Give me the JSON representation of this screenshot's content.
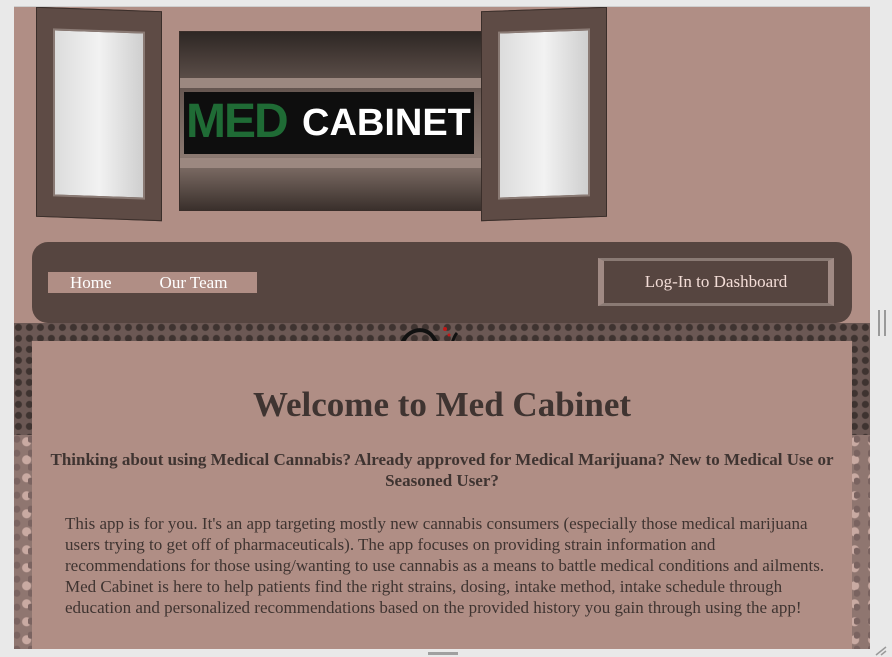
{
  "header": {
    "logo_med": "MED",
    "logo_cabinet": "CABINET"
  },
  "nav": {
    "home_label": "Home",
    "team_label": "Our Team",
    "login_label": "Log-In to Dashboard"
  },
  "main": {
    "title": "Welcome to Med Cabinet",
    "subtitle": "Thinking about using Medical Cannabis? Already approved for Medical Marijuana? New to Medical Use or Seasoned User?",
    "body": "This app is for you. It's an app targeting mostly new cannabis consumers (especially those medical marijuana users trying to get off of pharmaceuticals). The app focuses on providing strain information and recommendations for those using/wanting to use cannabis as a means to battle medical conditions and ailments. Med Cabinet is here to help patients find the right strains, dosing, intake method, intake schedule through education and personalized recommendations based on the provided history you gain through using the app!"
  },
  "colors": {
    "page_bg": "#b08e85",
    "nav_bg": "#564540",
    "text": "#3f3431",
    "logo_green": "#1f6b35"
  }
}
